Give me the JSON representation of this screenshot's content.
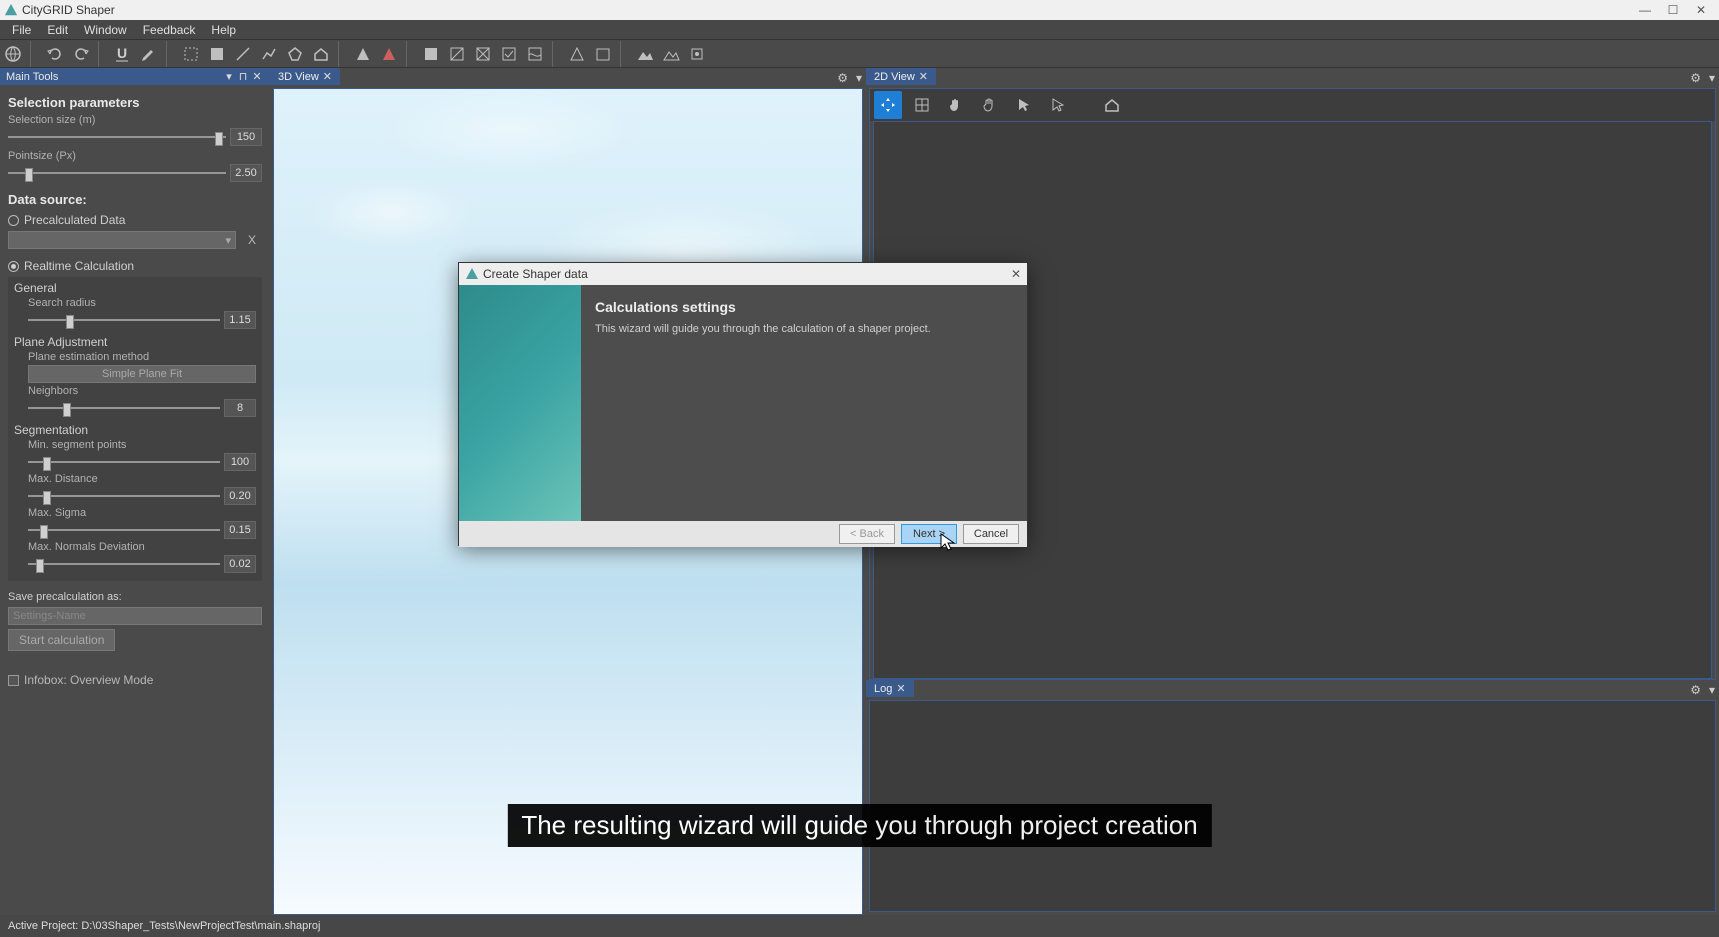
{
  "window": {
    "title": "CityGRID Shaper"
  },
  "menu": {
    "file": "File",
    "edit": "Edit",
    "window": "Window",
    "feedback": "Feedback",
    "help": "Help"
  },
  "panels": {
    "mainTools": {
      "tab": "Main Tools",
      "selection_heading": "Selection parameters",
      "selection_size_label": "Selection size (m)",
      "selection_size_value": "150",
      "pointsize_label": "Pointsize (Px)",
      "pointsize_value": "2.50",
      "datasource_heading": "Data source:",
      "precalc": "Precalculated Data",
      "clear": "X",
      "realtime": "Realtime Calculation",
      "general": "General",
      "search_radius_label": "Search radius",
      "search_radius_value": "1.15",
      "plane_adjustment": "Plane Adjustment",
      "plane_est_label": "Plane estimation method",
      "plane_est_value": "Simple Plane Fit",
      "neighbors_label": "Neighbors",
      "neighbors_value": "8",
      "segmentation": "Segmentation",
      "min_seg_label": "Min. segment points",
      "min_seg_value": "100",
      "max_dist_label": "Max. Distance",
      "max_dist_value": "0.20",
      "max_sigma_label": "Max. Sigma",
      "max_sigma_value": "0.15",
      "max_norm_label": "Max. Normals Deviation",
      "max_norm_value": "0.02",
      "save_precalc": "Save precalculation as:",
      "save_placeholder": "Settings-Name",
      "start_calc": "Start calculation",
      "infobox": "Infobox: Overview Mode"
    },
    "view3d": {
      "tab": "3D View"
    },
    "view2d": {
      "tab": "2D View"
    },
    "log": {
      "tab": "Log"
    }
  },
  "dialog": {
    "title": "Create Shaper data",
    "heading": "Calculations settings",
    "text": "This wizard will guide you through the calculation of a shaper project.",
    "back": "< Back",
    "next": "Next >",
    "cancel": "Cancel"
  },
  "status": {
    "text": "Active Project: D:\\03Shaper_Tests\\NewProjectTest\\main.shaproj"
  },
  "caption": "The resulting wizard will guide you through project creation"
}
